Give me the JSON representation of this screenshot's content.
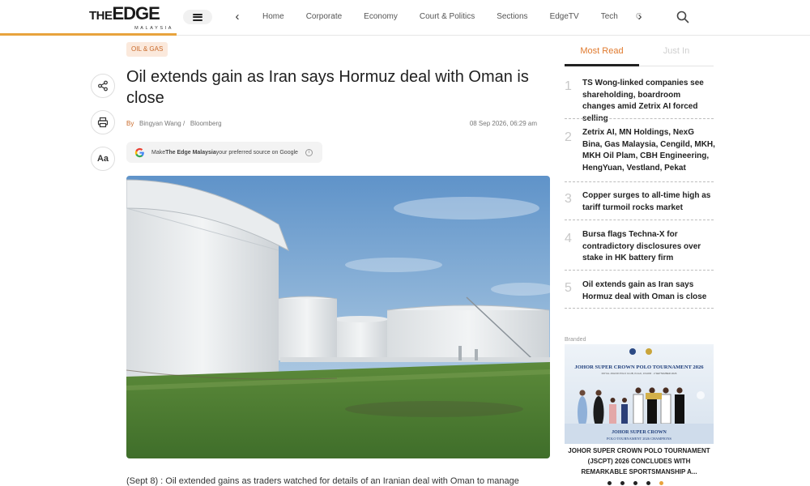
{
  "header": {
    "logo_the": "THE",
    "logo_edge": "EDGE",
    "logo_sub": "MALAYSIA",
    "nav_items": [
      "Home",
      "Corporate",
      "Economy",
      "Court & Politics",
      "Sections",
      "EdgeTV",
      "Tech"
    ],
    "nav_overflow": "C"
  },
  "article": {
    "tag": "OIL & GAS",
    "title": "Oil extends gain as Iran says Hormuz deal with Oman is close",
    "byline_prefix": "By",
    "author": "Bingyan Wang /",
    "source": "Bloomberg",
    "timestamp": "08 Sep 2026, 06:29 am",
    "google_prefix": "Make ",
    "google_brand": "The Edge Malaysia",
    "google_suffix": " your preferred source on Google",
    "lead": "(Sept 8) : Oil extended gains as traders watched for details of an Iranian deal with Oman to manage"
  },
  "tools": {
    "font_size_label": "Aa"
  },
  "sidebar": {
    "tab_most_read": "Most Read",
    "tab_just_in": "Just In",
    "most_read": [
      {
        "num": "1",
        "title": "TS Wong-linked companies see shareholding, boardroom changes amid Zetrix AI forced selling"
      },
      {
        "num": "2",
        "title": "Zetrix AI, MN Holdings, NexG Bina, Gas Malaysia, Cengild, MKH, MKH Oil Plam, CBH Engineering, HengYuan, Vestland, Pekat"
      },
      {
        "num": "3",
        "title": "Copper surges to all-time high as tariff turmoil rocks market"
      },
      {
        "num": "4",
        "title": "Bursa flags Techna-X for contradictory disclosures over stake in HK battery firm"
      },
      {
        "num": "5",
        "title": "Oil extends gain as Iran says Hormuz deal with Oman is close"
      }
    ],
    "branded_label": "Branded",
    "ad_banner_title": "JOHOR SUPER CROWN POLO TOURNAMENT 2026",
    "ad_banner_sub": "ROYAL JOHOR POLO CLUB, KULAI, JOHOR · 2 SEPTEMBER 2026",
    "ad_banner_bottom1": "JOHOR SUPER CROWN",
    "ad_banner_bottom2": "POLO TOURNAMENT 2026 CHAMPIONS",
    "ad_caption": "JOHOR SUPER CROWN POLO TOURNAMENT (JSCPT) 2026 CONCLUDES WITH REMARKABLE SPORTSMANSHIP A..."
  },
  "colors": {
    "accent": "#e8a33d",
    "tag_text": "#c96a2a",
    "tab_active": "#e07a2e"
  }
}
